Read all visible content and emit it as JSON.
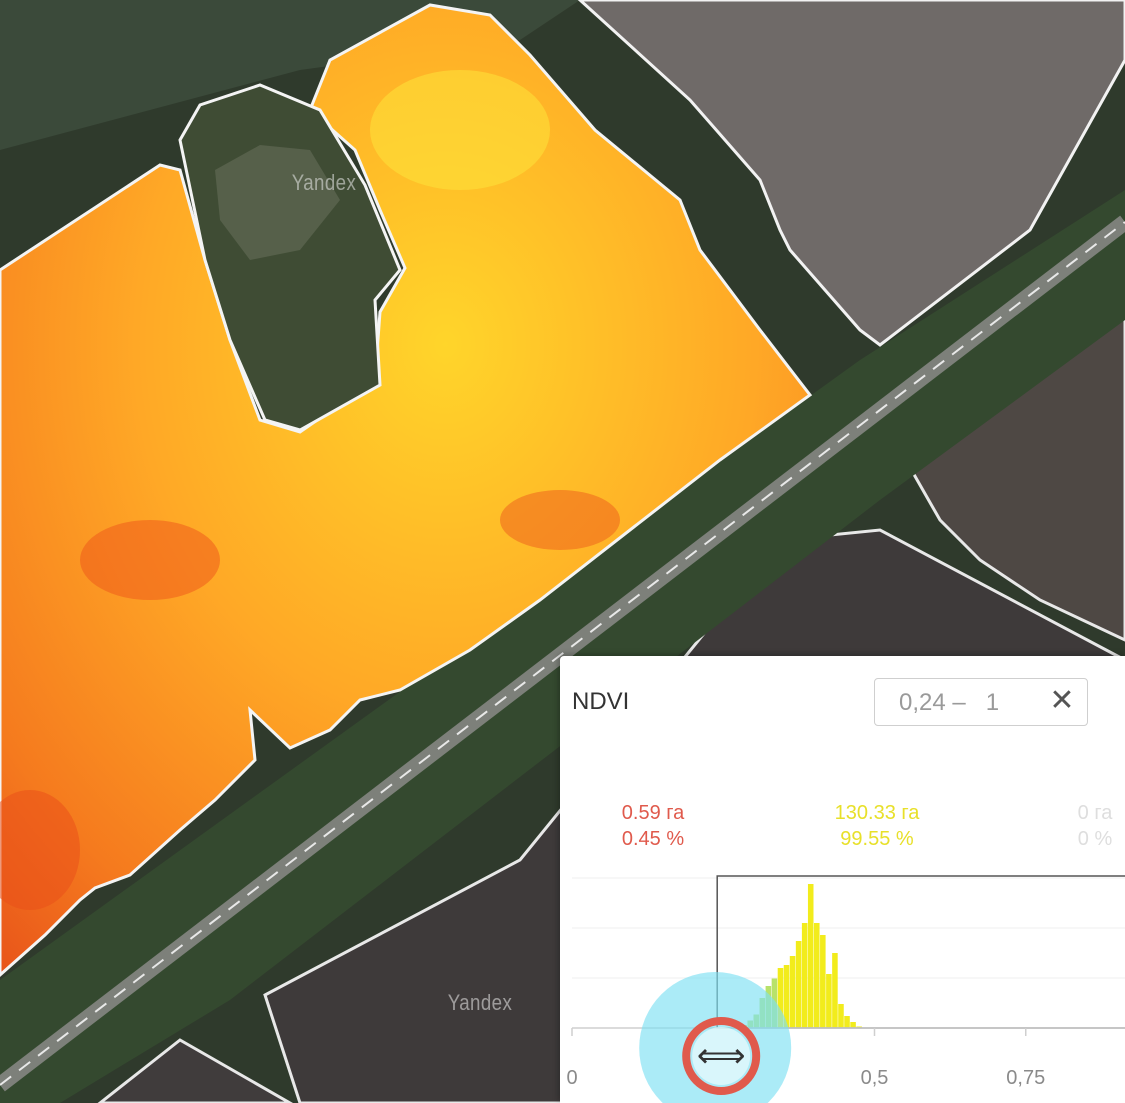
{
  "map": {
    "watermarks": [
      "Yandex",
      "Yandex"
    ]
  },
  "ndvi_panel": {
    "title": "NDVI",
    "range": {
      "low": "0,24",
      "separator": "–",
      "high": "1",
      "close_icon": "close-icon"
    },
    "stats": [
      {
        "area": "0.59 га",
        "percent": "0.45 %",
        "color": "#e05a4c"
      },
      {
        "area": "130.33 га",
        "percent": "99.55 %",
        "color": "#e8e02a"
      },
      {
        "area": "0 га",
        "percent": "0 %",
        "color": "#dedede"
      }
    ],
    "handle_icon": "double-arrow-icon"
  },
  "chart_data": {
    "type": "bar",
    "xlabel": "",
    "ylabel": "",
    "x_ticks": [
      "0",
      "0,5",
      "0,75"
    ],
    "xlim": [
      0,
      0.95
    ],
    "selection": [
      0.24,
      1
    ],
    "bin_width": 0.01,
    "bins": [
      0.28,
      0.29,
      0.3,
      0.31,
      0.32,
      0.33,
      0.34,
      0.35,
      0.36,
      0.37,
      0.38,
      0.39,
      0.4,
      0.41,
      0.42,
      0.43,
      0.44,
      0.45,
      0.46,
      0.47
    ],
    "values": [
      2,
      5,
      9,
      20,
      28,
      33,
      40,
      42,
      48,
      58,
      70,
      96,
      70,
      62,
      36,
      50,
      16,
      8,
      4,
      1
    ],
    "colors": {
      "low": "#b8e26a",
      "selected": "#f2ec1c",
      "selection_border": "#555555"
    }
  }
}
